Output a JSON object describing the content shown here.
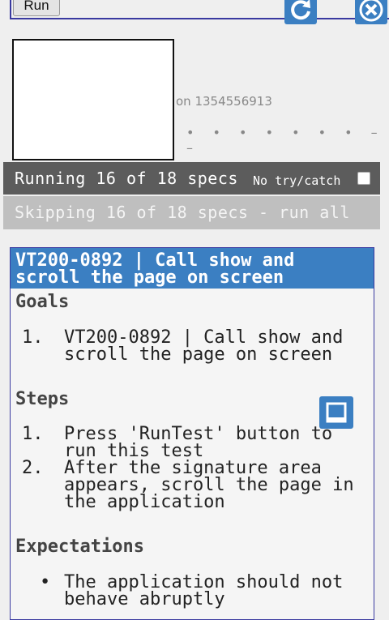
{
  "toolbar": {
    "run_label": "Run",
    "reload_icon": "reload-icon",
    "close_icon": "close-icon"
  },
  "signature": {
    "version_text": "on 1354556913",
    "dots_text": "• • • • • • • – –"
  },
  "status": {
    "running": "Running 16 of 18 specs",
    "no_try_catch_label": "No try/catch",
    "no_try_catch_checked": false,
    "skipping": "Skipping 16 of 18 specs - run all"
  },
  "spec": {
    "title": "VT200-0892 | Call show and scroll the page on screen",
    "goals_heading": "Goals",
    "goals": [
      {
        "num": "1.",
        "text": "VT200-0892 | Call show and scroll the page on screen"
      }
    ],
    "steps_heading": "Steps",
    "steps": [
      {
        "num": "1.",
        "text": "Press 'RunTest' button to run this test"
      },
      {
        "num": "2.",
        "text": "After the signature area appears, scroll the page in the application"
      }
    ],
    "expectations_heading": "Expectations",
    "expectations": [
      {
        "bullet": "•",
        "text": "The application should not behave abruptly"
      }
    ]
  },
  "colors": {
    "accent": "#3b7fc2",
    "running_bar": "#5c5c5c",
    "skipping_bar": "#bfbfbf",
    "border": "#3a3aa0"
  }
}
